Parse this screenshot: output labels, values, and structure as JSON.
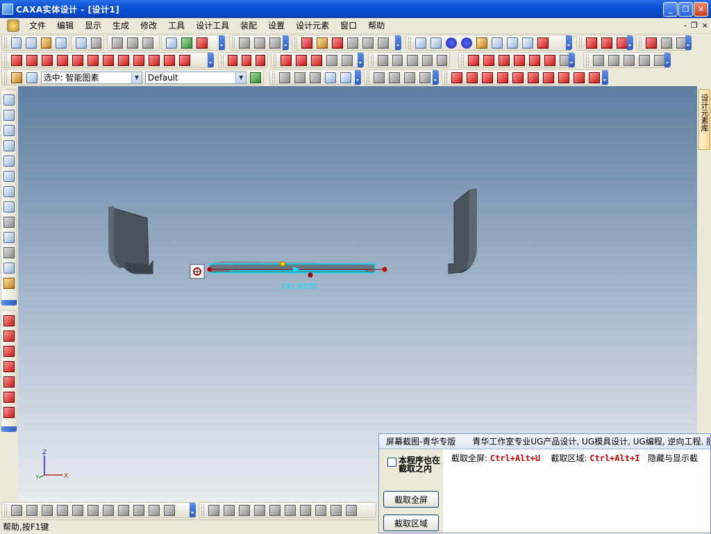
{
  "window": {
    "title": "CAXA实体设计 - [设计1]",
    "minimize": "_",
    "restore": "❐",
    "close": "✕"
  },
  "menu": {
    "items": [
      "文件",
      "编辑",
      "显示",
      "生成",
      "修改",
      "工具",
      "设计工具",
      "装配",
      "设置",
      "设计元素",
      "窗口",
      "帮助"
    ],
    "mdi_min": "-",
    "mdi_restore": "❐",
    "mdi_close": "×"
  },
  "selection_bar": {
    "filter_value": "选中: 智能图素",
    "style_value": "Default"
  },
  "right_panel": {
    "tab_label": "设计元素库"
  },
  "viewport": {
    "dimension_label": "141.8105",
    "axis_z": "Z",
    "axis_y": "Y",
    "axis_x": "X"
  },
  "status": {
    "text": "帮助,按F1键"
  },
  "capture_tool": {
    "title": "屏幕截图-青华专版",
    "subtitle": "青华工作室专业UG产品设计, UG模具设计, UG编程, 逆向工程, 服装",
    "checkbox_label": "本程序也在截取之内",
    "full_screen_label": "截取全屏:",
    "full_screen_key": "Ctrl+Alt+U",
    "region_label": "截取区域:",
    "region_key": "Ctrl+Alt+I",
    "hide_label": "隐藏与显示截",
    "btn_full": "截取全屏",
    "btn_region": "截取区域"
  },
  "colors": {
    "titlebar": "#0a52d6",
    "viewport_top": "#5f7ea0",
    "part_gray": "#4a535c",
    "hotkey_red": "#d00000",
    "dimension_cyan": "#00e5ff"
  }
}
